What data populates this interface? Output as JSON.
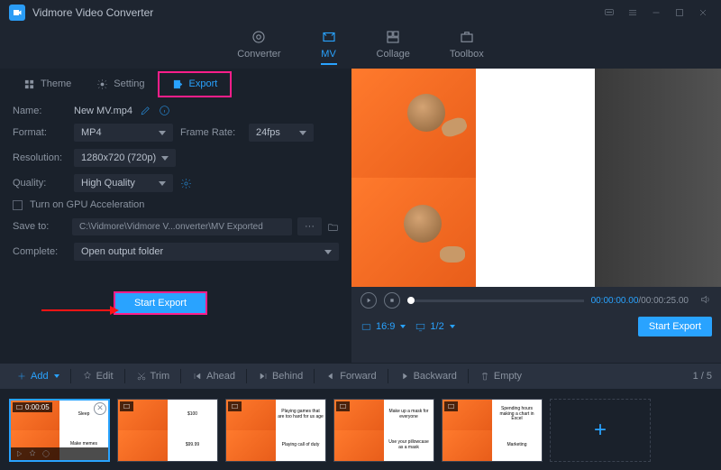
{
  "app": {
    "title": "Vidmore Video Converter"
  },
  "topnav": {
    "converter": "Converter",
    "mv": "MV",
    "collage": "Collage",
    "toolbox": "Toolbox"
  },
  "subtabs": {
    "theme": "Theme",
    "setting": "Setting",
    "export": "Export"
  },
  "form": {
    "name_label": "Name:",
    "name_value": "New MV.mp4",
    "format_label": "Format:",
    "format_value": "MP4",
    "framerate_label": "Frame Rate:",
    "framerate_value": "24fps",
    "resolution_label": "Resolution:",
    "resolution_value": "1280x720 (720p)",
    "quality_label": "Quality:",
    "quality_value": "High Quality",
    "gpu_label": "Turn on GPU Acceleration",
    "saveto_label": "Save to:",
    "saveto_value": "C:\\Vidmore\\Vidmore V...onverter\\MV Exported",
    "dots": "···",
    "complete_label": "Complete:",
    "complete_value": "Open output folder",
    "start_export": "Start Export"
  },
  "player": {
    "time_current": "00:00:00.00",
    "time_total": "/00:00:25.00",
    "aspect": "16:9",
    "page": "1/2",
    "start_export": "Start Export"
  },
  "toolbar": {
    "add": "Add",
    "edit": "Edit",
    "trim": "Trim",
    "ahead": "Ahead",
    "behind": "Behind",
    "forward": "Forward",
    "backward": "Backward",
    "empty": "Empty",
    "counter": "1 / 5"
  },
  "thumbs": {
    "t1": {
      "duration": "0:00:05",
      "text_top": "Sleep",
      "text_bot": "Make memes"
    },
    "t2": {
      "text_top": "$100",
      "text_bot": "$99.99"
    },
    "t3": {
      "text_top": "Playing games that are too hard for us age",
      "text_bot": "Playing call of duty"
    },
    "t4": {
      "text_top": "Make up a mask for everyone",
      "text_bot": "Use your pillowcase as a mask"
    },
    "t5": {
      "text_top": "Spending hours making a chart in Excel",
      "text_bot": "Marketing"
    }
  }
}
